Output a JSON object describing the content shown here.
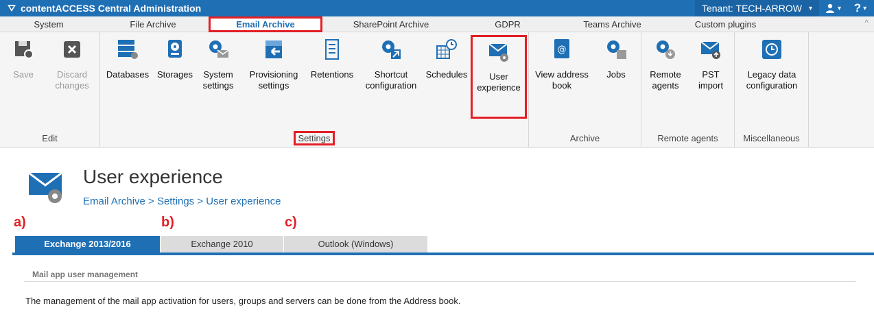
{
  "app": {
    "title": "contentACCESS Central Administration",
    "tenant": "Tenant: TECH-ARROW"
  },
  "tabs": [
    "System",
    "File Archive",
    "Email Archive",
    "SharePoint Archive",
    "GDPR",
    "Teams Archive",
    "Custom plugins"
  ],
  "ribbon": {
    "save": "Save",
    "discard_1": "Discard",
    "discard_2": "changes",
    "databases": "Databases",
    "storages": "Storages",
    "system_1": "System",
    "system_2": "settings",
    "prov_1": "Provisioning",
    "prov_2": "settings",
    "retentions": "Retentions",
    "shortcut_1": "Shortcut",
    "shortcut_2": "configuration",
    "schedules": "Schedules",
    "ux_1": "User",
    "ux_2": "experience",
    "addr_1": "View address",
    "addr_2": "book",
    "jobs": "Jobs",
    "remote_1": "Remote",
    "remote_2": "agents",
    "pst_1": "PST",
    "pst_2": "import",
    "legacy_1": "Legacy data",
    "legacy_2": "configuration",
    "groups": {
      "edit": "Edit",
      "settings": "Settings",
      "archive": "Archive",
      "remote": "Remote agents",
      "misc": "Miscellaneous"
    }
  },
  "page": {
    "title": "User experience",
    "breadcrumb": "Email Archive > Settings > User experience",
    "markers": [
      "a)",
      "b)",
      "c)"
    ],
    "content_tabs": [
      "Exchange 2013/2016",
      "Exchange 2010",
      "Outlook (Windows)"
    ],
    "section_title": "Mail app user management",
    "description": "The management of the mail app activation for users, groups and servers can be done from the Address book."
  },
  "colors": {
    "accent": "#1f6fb5",
    "highlight": "#e31e24"
  }
}
